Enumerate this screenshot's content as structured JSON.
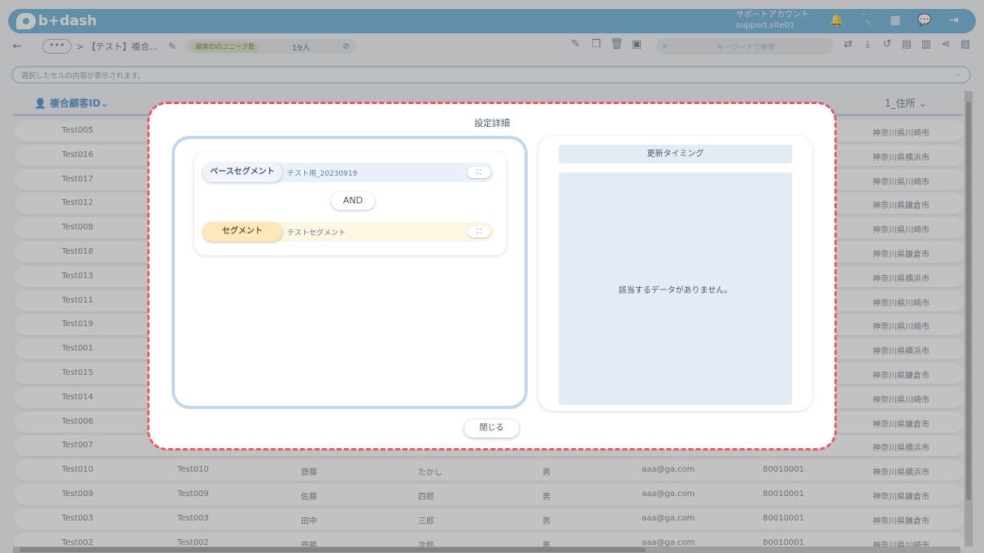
{
  "app": {
    "logo": "b+dash",
    "account_line1": "サポートアカウント",
    "account_line2": "support.site01"
  },
  "top_icons": [
    "bell-icon",
    "wrench-icon",
    "grid-icon",
    "chat-icon",
    "logout-icon"
  ],
  "toolbar": {
    "back": "←",
    "more": "•••",
    "breadcrumb": "> 【テスト】複合…",
    "unique_label": "顧客IDのユニーク数",
    "unique_value": "19人",
    "search_placeholder": "キーワードで検索"
  },
  "cellbar": {
    "placeholder": "選択したセルの内容が表示されます。",
    "chevron": "⌄"
  },
  "table": {
    "first_header": "複合顧客ID",
    "last_header": "1_住所",
    "header_arrow": "⌄",
    "rows": [
      {
        "id": "Test005",
        "addr": "神奈川県川崎市"
      },
      {
        "id": "Test016",
        "addr": "神奈川県横浜市"
      },
      {
        "id": "Test017",
        "addr": "神奈川県川崎市"
      },
      {
        "id": "Test012",
        "addr": "神奈川県鎌倉市"
      },
      {
        "id": "Test008",
        "addr": "神奈川県川崎市"
      },
      {
        "id": "Test018",
        "addr": "神奈川県鎌倉市"
      },
      {
        "id": "Test013",
        "addr": "神奈川県横浜市"
      },
      {
        "id": "Test011",
        "addr": "神奈川県川崎市"
      },
      {
        "id": "Test019",
        "addr": "神奈川県川崎市"
      },
      {
        "id": "Test001",
        "addr": "神奈川県横浜市"
      },
      {
        "id": "Test015",
        "addr": "神奈川県鎌倉市"
      },
      {
        "id": "Test014",
        "addr": "神奈川県川崎市"
      },
      {
        "id": "Test006",
        "addr": "神奈川県鎌倉市"
      },
      {
        "id": "Test007",
        "addr": "神奈川県横浜市"
      },
      {
        "id": "Test010",
        "id2": "Test010",
        "last": "齋藤",
        "first": "たかし",
        "sex": "男",
        "mail": "aaa@ga.com",
        "code": "80010001",
        "addr": "神奈川県横浜市"
      },
      {
        "id": "Test009",
        "id2": "Test009",
        "last": "佐藤",
        "first": "四郎",
        "sex": "男",
        "mail": "aaa@ga.com",
        "code": "80010001",
        "addr": "神奈川県鎌倉市"
      },
      {
        "id": "Test003",
        "id2": "Test003",
        "last": "田中",
        "first": "三郎",
        "sex": "男",
        "mail": "aaa@ga.com",
        "code": "80010001",
        "addr": "神奈川県鎌倉市"
      },
      {
        "id": "Test002",
        "id2": "Test002",
        "last": "齋藤",
        "first": "次郎",
        "sex": "男",
        "mail": "aaa@ga.com",
        "code": "80010001",
        "addr": "神奈川県川崎市"
      }
    ]
  },
  "modal": {
    "title": "設定詳細",
    "base_label": "ベースセグメント",
    "base_value": "テスト用_20230919",
    "operator": "AND",
    "seg_label": "セグメント",
    "seg_value": "テストセグメント",
    "expand_glyph": "⛶",
    "timing_header": "更新タイミング",
    "empty_text": "該当するデータがありません。",
    "close_label": "閉じる"
  }
}
